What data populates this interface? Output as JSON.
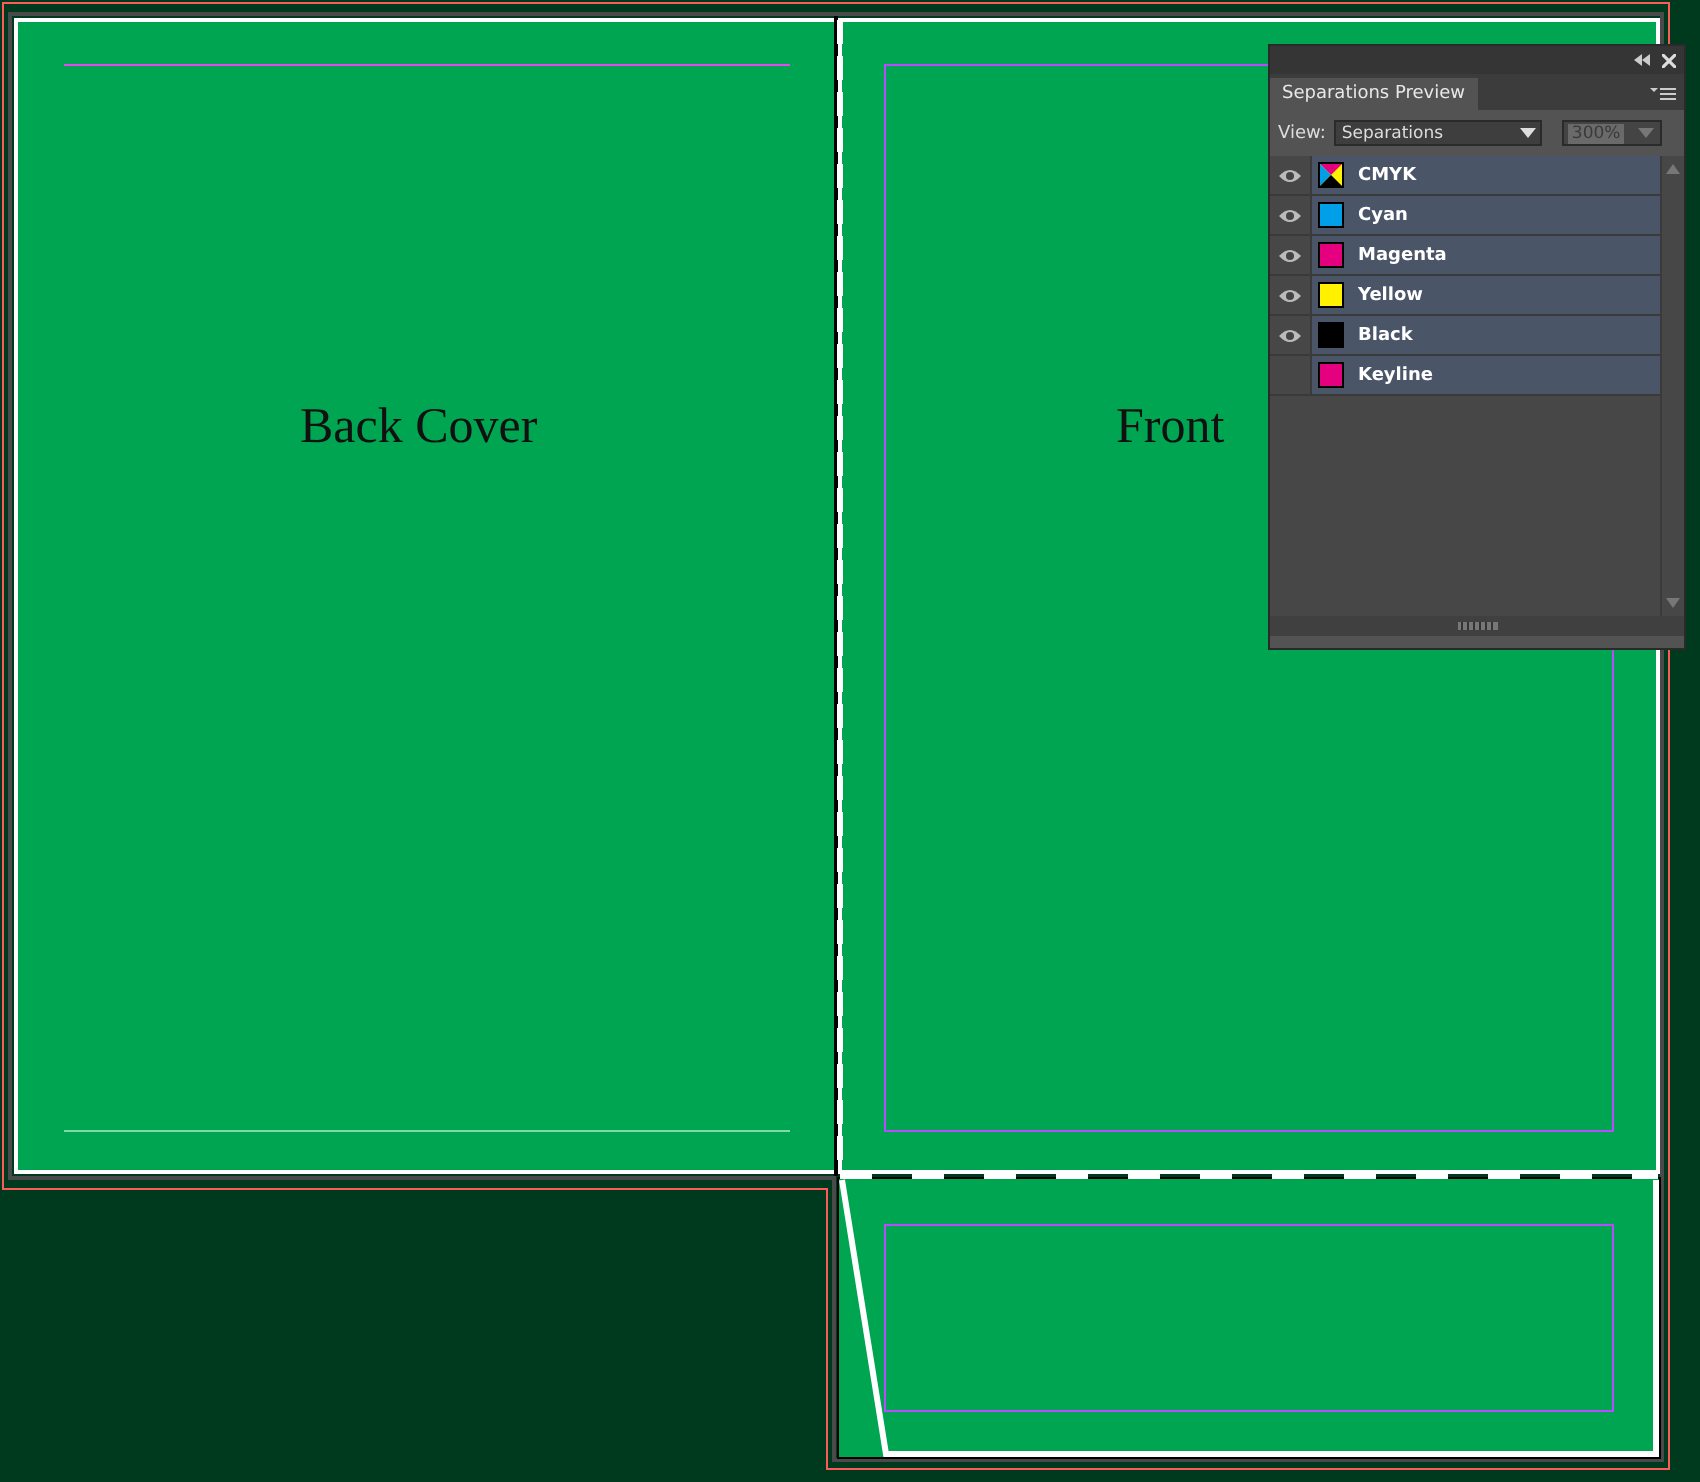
{
  "document": {
    "pages": [
      {
        "label": "Back Cover"
      },
      {
        "label": "Front"
      }
    ]
  },
  "panel": {
    "title": "Separations Preview",
    "view_label": "View:",
    "view": "Separations",
    "zoom": {
      "value": "300%",
      "disabled": true
    },
    "separations": [
      {
        "name": "CMYK",
        "kind": "composite",
        "visible": true
      },
      {
        "name": "Cyan",
        "kind": "ink",
        "color": "#00a0e9",
        "visible": true
      },
      {
        "name": "Magenta",
        "kind": "ink",
        "color": "#e4007f",
        "visible": true
      },
      {
        "name": "Yellow",
        "kind": "ink",
        "color": "#fff100",
        "visible": true
      },
      {
        "name": "Black",
        "kind": "ink",
        "color": "#000000",
        "visible": true
      },
      {
        "name": "Keyline",
        "kind": "ink",
        "color": "#e4007f",
        "visible": false
      }
    ]
  }
}
